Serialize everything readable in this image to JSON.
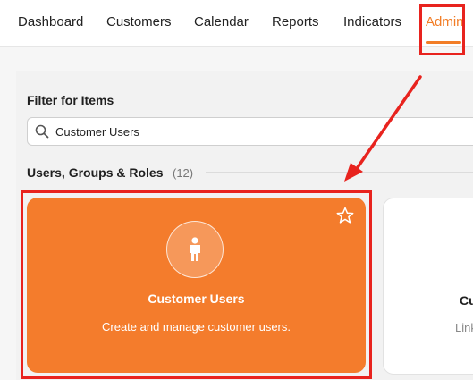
{
  "nav": {
    "items": [
      {
        "label": "Dashboard"
      },
      {
        "label": "Customers"
      },
      {
        "label": "Calendar"
      },
      {
        "label": "Reports"
      },
      {
        "label": "Indicators"
      },
      {
        "label": "Admin"
      }
    ],
    "active": "Admin"
  },
  "filter": {
    "title": "Filter for Items",
    "value": "Customer Users"
  },
  "section": {
    "title": "Users, Groups & Roles",
    "count": "(12)"
  },
  "cards": [
    {
      "title": "Customer Users",
      "description": "Create and manage customer users.",
      "color": "#f47c2c"
    },
    {
      "title": "Cu",
      "description": "Link"
    }
  ],
  "colors": {
    "accent": "#f27d26",
    "annotation": "#e8231e"
  },
  "icons": {
    "search": "search-icon",
    "star": "star-icon",
    "user": "user-icon"
  }
}
